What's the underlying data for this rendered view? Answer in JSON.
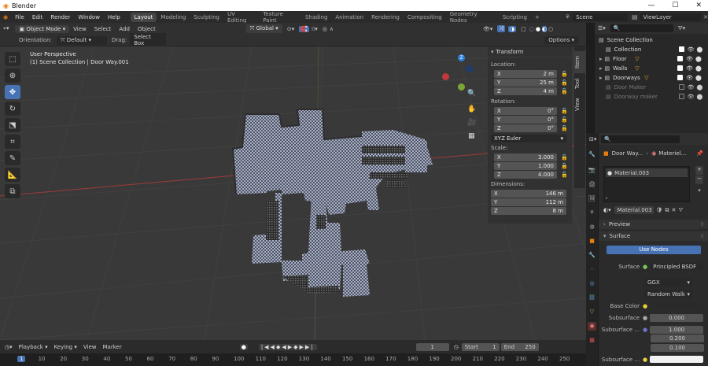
{
  "window": {
    "title": "Blender"
  },
  "menu": [
    "File",
    "Edit",
    "Render",
    "Window",
    "Help"
  ],
  "workspaces": [
    "Layout",
    "Modeling",
    "Sculpting",
    "UV Editing",
    "Texture Paint",
    "Shading",
    "Animation",
    "Rendering",
    "Compositing",
    "Geometry Nodes",
    "Scripting"
  ],
  "scene": {
    "name": "Scene",
    "view_layer": "ViewLayer"
  },
  "header": {
    "mode": "Object Mode",
    "view": "View",
    "select": "Select",
    "add": "Add",
    "object": "Object",
    "transform": "Global"
  },
  "header2": {
    "orientation_label": "Orientation:",
    "orientation": "Default",
    "drag_label": "Drag:",
    "drag": "Select Box",
    "options": "Options"
  },
  "viewport": {
    "perspective": "User Perspective",
    "collection_info": "(1) Scene Collection | Door Way.001",
    "accent": "#4772b3"
  },
  "npanel": {
    "title": "Transform",
    "location_label": "Location:",
    "location": [
      {
        "axis": "X",
        "value": "2 m"
      },
      {
        "axis": "Y",
        "value": "25 m"
      },
      {
        "axis": "Z",
        "value": "4 m"
      }
    ],
    "rotation_label": "Rotation:",
    "rotation": [
      {
        "axis": "X",
        "value": "0°"
      },
      {
        "axis": "Y",
        "value": "0°"
      },
      {
        "axis": "Z",
        "value": "0°"
      }
    ],
    "euler": "XYZ Euler",
    "scale_label": "Scale:",
    "scale": [
      {
        "axis": "X",
        "value": "3.000"
      },
      {
        "axis": "Y",
        "value": "1.000"
      },
      {
        "axis": "Z",
        "value": "4.000"
      }
    ],
    "dimensions_label": "Dimensions:",
    "dimensions": [
      {
        "axis": "X",
        "value": "146 m"
      },
      {
        "axis": "Y",
        "value": "112 m"
      },
      {
        "axis": "Z",
        "value": "8 m"
      }
    ],
    "tabs": [
      "Item",
      "Tool",
      "View"
    ]
  },
  "outliner": {
    "root": "Scene Collection",
    "items": [
      {
        "name": "Collection",
        "enabled": true
      },
      {
        "name": "Floor",
        "enabled": true
      },
      {
        "name": "Walls",
        "enabled": true
      },
      {
        "name": "Doorways",
        "enabled": true
      },
      {
        "name": "Door Maker",
        "enabled": false
      },
      {
        "name": "Doorway maker",
        "enabled": false
      }
    ]
  },
  "properties": {
    "breadcrumb_object": "Door Way...",
    "breadcrumb_material": "Materiel...",
    "slot": "Material.003",
    "material_name": "Material.003",
    "preview": "Preview",
    "surface_section": "Surface",
    "use_nodes": "Use Nodes",
    "surface_label": "Surface",
    "surface_value": "Principled BSDF",
    "distribution": "GGX",
    "subsurface_method": "Random Walk",
    "base_color_label": "Base Color",
    "subsurface_label": "Subsurface",
    "subsurface_value": "0.000",
    "subsurface_radius_label": "Subsurface ...",
    "subsurface_radius": [
      "1.000",
      "0.200",
      "0.100"
    ],
    "subsurface_color_label": "Subsurface ..."
  },
  "timeline": {
    "playback": "Playback",
    "keying": "Keying",
    "view": "View",
    "marker": "Marker",
    "current_frame": "1",
    "start_label": "Start",
    "start": "1",
    "end_label": "End",
    "end": "250",
    "ruler": [
      "1",
      "10",
      "20",
      "30",
      "40",
      "50",
      "60",
      "70",
      "80",
      "90",
      "100",
      "110",
      "120",
      "130",
      "140",
      "150",
      "160",
      "170",
      "180",
      "190",
      "200",
      "210",
      "220",
      "230",
      "240",
      "250"
    ]
  }
}
